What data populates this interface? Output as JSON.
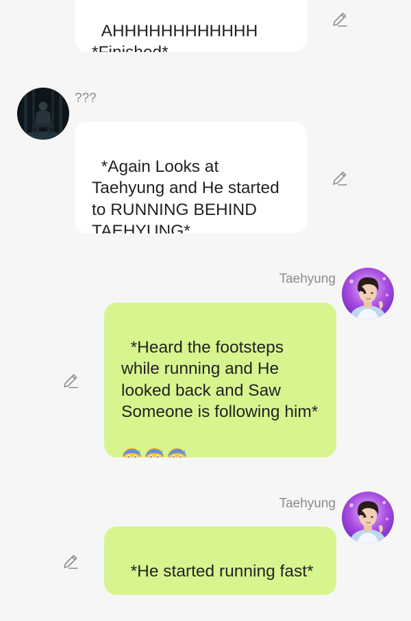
{
  "messages": [
    {
      "sender": "",
      "direction": "incoming",
      "text": "AHHHHHHHHHHHH\n*Finished*"
    },
    {
      "sender": "???",
      "direction": "incoming",
      "avatar_icon": "dark-figure-avatar-icon",
      "text": "*Again Looks at Taehyung and He started to RUNNING BEHIND TAEHYUNG*"
    },
    {
      "sender": "Taehyung",
      "direction": "outgoing",
      "avatar_icon": "taehyung-avatar-icon",
      "text": "*Heard the footsteps while running and He looked back and Saw Someone is following him*",
      "emoji": [
        "anxious-face-with-sweat",
        "anxious-face-with-sweat",
        "anxious-face-with-sweat"
      ]
    },
    {
      "sender": "Taehyung",
      "direction": "outgoing",
      "avatar_icon": "taehyung-avatar-icon",
      "text": "*He started running fast*"
    }
  ],
  "icons": {
    "edit": "pencil-edit-icon"
  },
  "colors": {
    "background": "#f6f6f6",
    "incoming_bubble": "#ffffff",
    "outgoing_bubble": "#d7f58f",
    "sender_name": "#8a8a8a",
    "message_text": "#222222"
  }
}
